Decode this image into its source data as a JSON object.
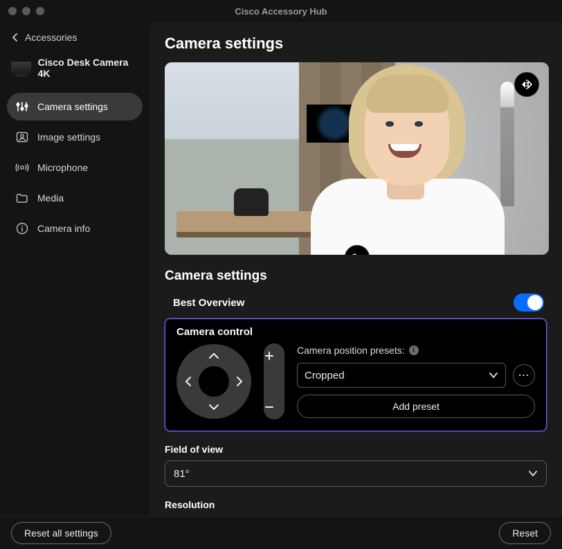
{
  "app_title": "Cisco Accessory Hub",
  "back_label": "Accessories",
  "device_name": "Cisco Desk Camera 4K",
  "nav": {
    "camera_settings": "Camera settings",
    "image_settings": "Image settings",
    "microphone": "Microphone",
    "media": "Media",
    "camera_info": "Camera info"
  },
  "page_heading": "Camera settings",
  "section_heading": "Camera settings",
  "best_overview": {
    "label": "Best Overview",
    "on": true
  },
  "camera_control": {
    "title": "Camera control",
    "presets_label": "Camera position presets:",
    "preset_selected": "Cropped",
    "add_preset_label": "Add preset"
  },
  "field_of_view": {
    "label": "Field of view",
    "value": "81°"
  },
  "resolution": {
    "label": "Resolution"
  },
  "footer": {
    "reset_all": "Reset all settings",
    "reset": "Reset"
  },
  "icons": {
    "more": "⋯"
  }
}
